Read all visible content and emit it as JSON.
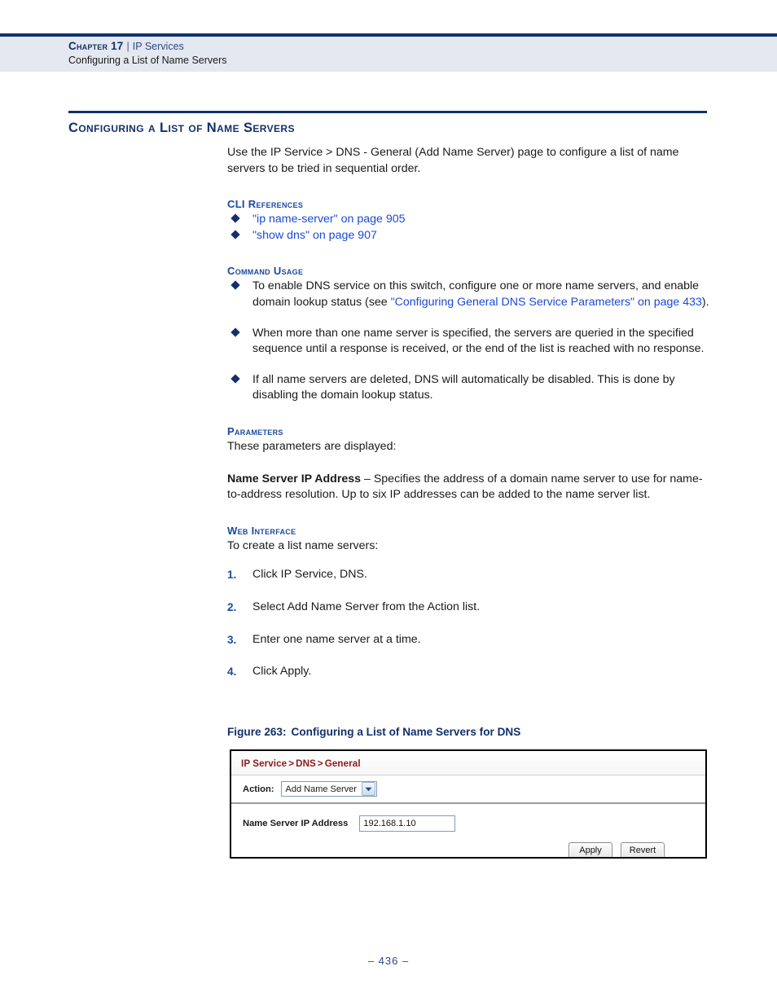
{
  "header": {
    "chapter": "Chapter 17",
    "separator": "|",
    "chapter_topic": "IP Services",
    "section": "Configuring a List of Name Servers"
  },
  "title": "Configuring a List of Name Servers",
  "intro": "Use the IP Service > DNS - General (Add Name Server) page to configure a list of name servers to be tried in sequential order.",
  "cli_references": {
    "heading": "CLI References",
    "items": [
      "\"ip name-server\" on page 905",
      "\"show dns\" on page 907"
    ]
  },
  "command_usage": {
    "heading": "Command Usage",
    "items": [
      {
        "text_before": "To enable DNS service on this switch, configure one or more name servers, and enable domain lookup status (see ",
        "link": "\"Configuring General DNS Service Parameters\" on page 433",
        "text_after": ")."
      },
      {
        "text_before": "When more than one name server is specified, the servers are queried in the specified sequence until a response is received, or the end of the list is reached with no response.",
        "link": "",
        "text_after": ""
      },
      {
        "text_before": "If all name servers are deleted, DNS will automatically be disabled. This is done by disabling the domain lookup status.",
        "link": "",
        "text_after": ""
      }
    ]
  },
  "parameters": {
    "heading": "Parameters",
    "lead_in": "These parameters are displayed:",
    "entries": [
      {
        "term": "Name Server IP Address",
        "description": " – Specifies the address of a domain name server to use for name-to-address resolution. Up to six IP addresses can be added to the name server list."
      }
    ]
  },
  "web_interface": {
    "heading": "Web Interface",
    "lead_in": "To create a list name servers:",
    "steps": [
      {
        "num": "1.",
        "text": "Click IP Service, DNS."
      },
      {
        "num": "2.",
        "text": "Select Add Name Server from the Action list."
      },
      {
        "num": "3.",
        "text": "Enter one name server at a time."
      },
      {
        "num": "4.",
        "text": "Click Apply."
      }
    ]
  },
  "figure": {
    "number": "Figure 263:",
    "caption": "Configuring a List of Name Servers for DNS",
    "screenshot": {
      "breadcrumb": {
        "part1": "IP Service",
        "sep1": ">",
        "part2": "DNS",
        "sep2": ">",
        "part3": "General",
        "full": "IP Service > DNS > General"
      },
      "action_label": "Action:",
      "action_value": "Add Name Server",
      "action_options": [
        "Add Name Server"
      ],
      "field_label": "Name Server IP Address",
      "field_value": "192.168.1.10",
      "apply_button": "Apply",
      "revert_button": "Revert"
    }
  },
  "footer": {
    "page_marker": "–  436  –"
  },
  "colors": {
    "navy": "#12306b",
    "link_blue": "#1a4ad6",
    "heading_blue": "#1a4a9e",
    "header_band": "#e4e8f0",
    "breadcrumb_red": "#8b1a1a"
  }
}
